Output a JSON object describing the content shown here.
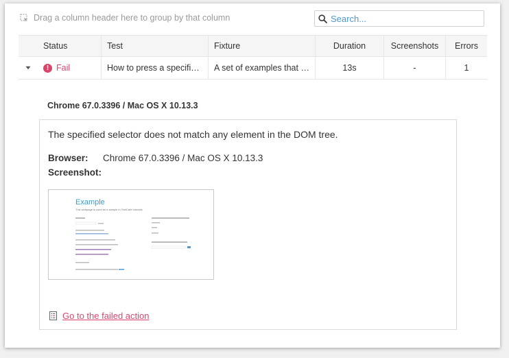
{
  "toolbar": {
    "group_hint": "Drag a column header here to group by that column",
    "search_placeholder": "Search..."
  },
  "grid": {
    "columns": [
      "Status",
      "Test",
      "Fixture",
      "Duration",
      "Screenshots",
      "Errors"
    ],
    "rows": [
      {
        "status": "Fail",
        "test": "How to press a specified key (Ctrl+X and Ctrl+V)",
        "fixture": "A set of examples that illustrate how to use TestCafe API",
        "duration": "13s",
        "screenshots": "-",
        "errors": "1"
      }
    ]
  },
  "details": {
    "browser_title": "Chrome 67.0.3396 / Mac OS X 10.13.3",
    "error_message": "The specified selector does not match any element in the DOM tree.",
    "browser_label": "Browser:",
    "browser_value": "Chrome 67.0.3396 / Mac OS X 10.13.3",
    "screenshot_label": "Screenshot:",
    "screenshot": {
      "heading": "Example",
      "subheading": "This webpage is used as a sample in TestCafe tutorials."
    },
    "failed_action_link": "Go to the failed action"
  },
  "colors": {
    "fail": "#d9466c",
    "search_placeholder": "#4a9ad6",
    "screenshot_heading": "#2aa0d8"
  }
}
